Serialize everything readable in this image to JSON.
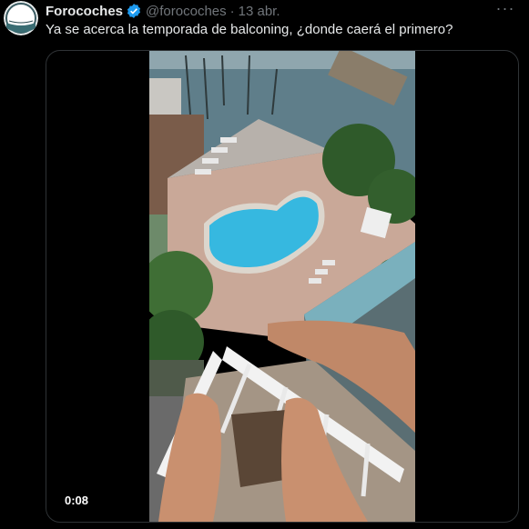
{
  "tweet": {
    "author_name": "Forocoches",
    "handle": "@forocoches",
    "separator": "·",
    "date": "13 abr.",
    "text": "Ya se acerca la temporada de balconing, ¿donde caerá el primero?",
    "more_label": "···",
    "verified": true
  },
  "video": {
    "timestamp": "0:08"
  },
  "colors": {
    "background": "#000000",
    "text_primary": "#e7e9ea",
    "text_secondary": "#71767b",
    "verified_badge": "#1d9bf0",
    "border": "#2f3336"
  }
}
